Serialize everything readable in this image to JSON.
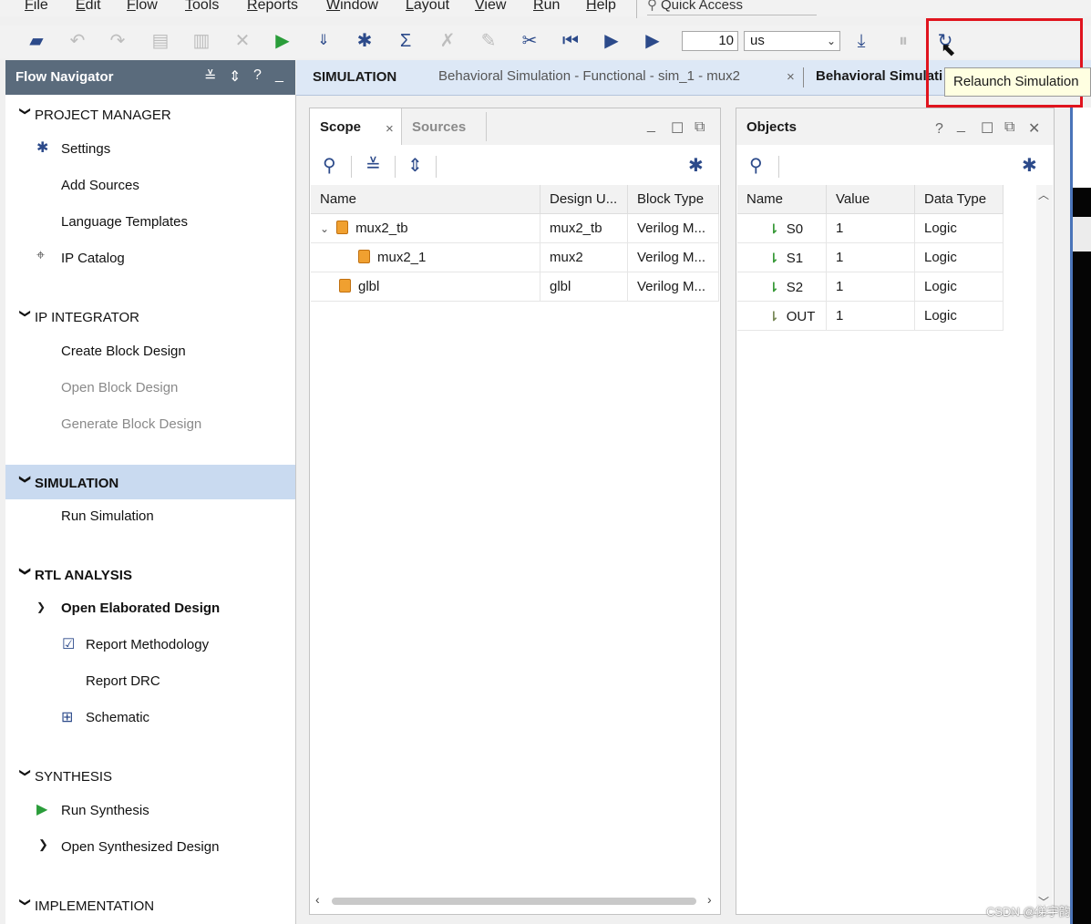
{
  "menu": [
    "File",
    "Edit",
    "Flow",
    "Tools",
    "Reports",
    "Window",
    "Layout",
    "View",
    "Run",
    "Help"
  ],
  "quick_access": "Quick Access",
  "toolbar": {
    "time_value": "10",
    "time_unit": "us",
    "tooltip": "Relaunch Simulation"
  },
  "flow_navigator": {
    "title": "Flow Navigator",
    "sections": {
      "project_manager": "PROJECT MANAGER",
      "settings": "Settings",
      "add_sources": "Add Sources",
      "language_templates": "Language Templates",
      "ip_catalog": "IP Catalog",
      "ip_integrator": "IP INTEGRATOR",
      "create_block_design": "Create Block Design",
      "open_block_design": "Open Block Design",
      "generate_block_design": "Generate Block Design",
      "simulation": "SIMULATION",
      "run_simulation": "Run Simulation",
      "rtl_analysis": "RTL ANALYSIS",
      "open_elaborated_design": "Open Elaborated Design",
      "report_methodology": "Report Methodology",
      "report_drc": "Report DRC",
      "schematic": "Schematic",
      "synthesis": "SYNTHESIS",
      "run_synthesis": "Run Synthesis",
      "open_synthesized_design": "Open Synthesized Design",
      "implementation": "IMPLEMENTATION"
    }
  },
  "simulation_bar": {
    "label": "SIMULATION",
    "tab1": "Behavioral Simulation - Functional - sim_1 - mux2",
    "tab2": "Behavioral Simulati"
  },
  "scope_panel": {
    "tab_scope": "Scope",
    "tab_sources": "Sources",
    "columns": [
      "Name",
      "Design U...",
      "Block Type"
    ],
    "rows": [
      {
        "name": "mux2_tb",
        "design": "mux2_tb",
        "type": "Verilog M..."
      },
      {
        "name": "mux2_1",
        "design": "mux2",
        "type": "Verilog M..."
      },
      {
        "name": "glbl",
        "design": "glbl",
        "type": "Verilog M..."
      }
    ]
  },
  "objects_panel": {
    "title": "Objects",
    "columns": [
      "Name",
      "Value",
      "Data Type"
    ],
    "rows": [
      {
        "name": "S0",
        "value": "1",
        "type": "Logic"
      },
      {
        "name": "S1",
        "value": "1",
        "type": "Logic"
      },
      {
        "name": "S2",
        "value": "1",
        "type": "Logic"
      },
      {
        "name": "OUT",
        "value": "1",
        "type": "Logic"
      }
    ]
  },
  "watermark": "CSDN @俤宇韵",
  "colors": {
    "accent_blue": "#2c4a8a",
    "run_green": "#2a9d3a",
    "highlight_red": "#e0141e",
    "nav_header": "#5a6b7c",
    "selected_band": "#c9daf0"
  }
}
